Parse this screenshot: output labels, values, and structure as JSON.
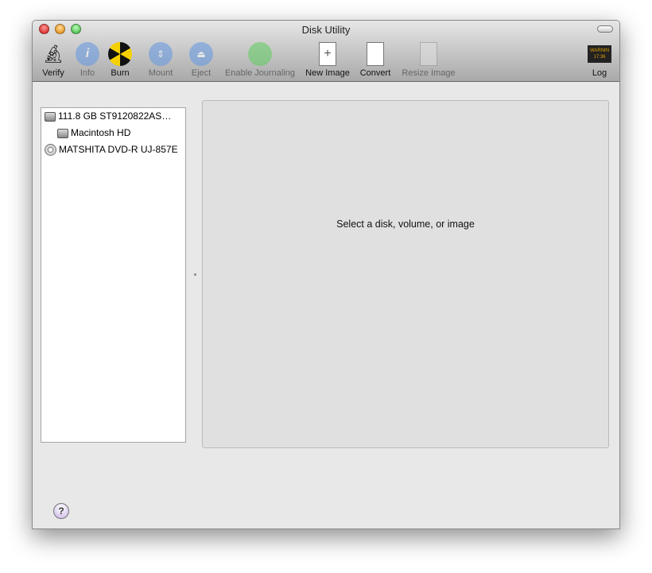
{
  "window": {
    "title": "Disk Utility"
  },
  "toolbar": [
    {
      "label": "Verify",
      "icon": "microscope-icon",
      "enabled": true
    },
    {
      "label": "Info",
      "icon": "info-icon",
      "enabled": false
    },
    {
      "label": "Burn",
      "icon": "radiation-icon",
      "enabled": true
    },
    {
      "label": "Mount",
      "icon": "mount-icon",
      "enabled": false
    },
    {
      "label": "Eject",
      "icon": "eject-icon",
      "enabled": false
    },
    {
      "label": "Enable Journaling",
      "icon": "journaling-icon",
      "enabled": false
    },
    {
      "label": "New Image",
      "icon": "new-image-icon",
      "enabled": true
    },
    {
      "label": "Convert",
      "icon": "convert-icon",
      "enabled": true
    },
    {
      "label": "Resize Image",
      "icon": "resize-image-icon",
      "enabled": false
    }
  ],
  "log": {
    "label": "Log",
    "icon_text": "WARNIN\n17:36"
  },
  "sidebar": {
    "items": [
      {
        "label": "111.8 GB ST9120822AS…",
        "icon": "hard-disk-icon"
      },
      {
        "label": "Macintosh HD",
        "icon": "volume-icon"
      },
      {
        "label": "MATSHITA DVD-R UJ-857E",
        "icon": "optical-drive-icon"
      }
    ]
  },
  "main": {
    "message": "Select a disk, volume, or image"
  },
  "help": {
    "label": "?"
  }
}
